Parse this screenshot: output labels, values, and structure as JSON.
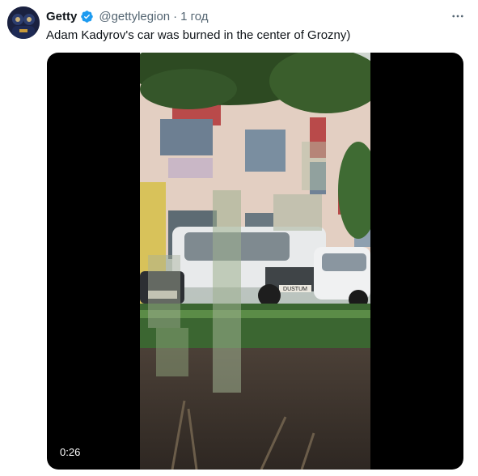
{
  "tweet": {
    "display_name": "Getty",
    "handle": "@gettylegion",
    "separator": "·",
    "time": "1 год",
    "text": "Adam Kadyrov's car was burned in the center of Grozny)",
    "verified": true
  },
  "media": {
    "type": "video",
    "duration": "0:26",
    "plate_text": "DUSTUM"
  },
  "icons": {
    "avatar": "avatar",
    "verified": "verified-badge-icon",
    "more": "more-horizontal-icon"
  },
  "colors": {
    "verified_blue": "#1d9bf0",
    "secondary_text": "#536471",
    "primary_text": "#0f1419"
  }
}
